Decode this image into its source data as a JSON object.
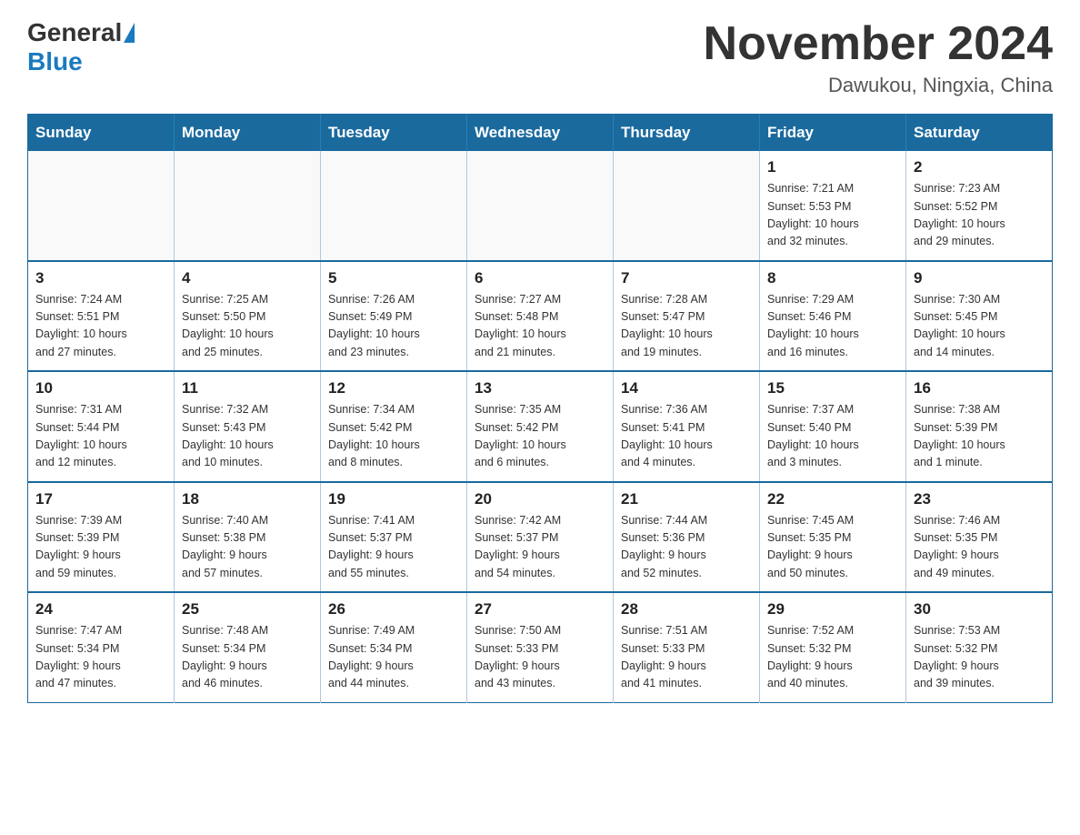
{
  "header": {
    "logo_general": "General",
    "logo_blue": "Blue",
    "month_title": "November 2024",
    "location": "Dawukou, Ningxia, China"
  },
  "days_of_week": [
    "Sunday",
    "Monday",
    "Tuesday",
    "Wednesday",
    "Thursday",
    "Friday",
    "Saturday"
  ],
  "weeks": [
    [
      {
        "day": "",
        "info": ""
      },
      {
        "day": "",
        "info": ""
      },
      {
        "day": "",
        "info": ""
      },
      {
        "day": "",
        "info": ""
      },
      {
        "day": "",
        "info": ""
      },
      {
        "day": "1",
        "info": "Sunrise: 7:21 AM\nSunset: 5:53 PM\nDaylight: 10 hours\nand 32 minutes."
      },
      {
        "day": "2",
        "info": "Sunrise: 7:23 AM\nSunset: 5:52 PM\nDaylight: 10 hours\nand 29 minutes."
      }
    ],
    [
      {
        "day": "3",
        "info": "Sunrise: 7:24 AM\nSunset: 5:51 PM\nDaylight: 10 hours\nand 27 minutes."
      },
      {
        "day": "4",
        "info": "Sunrise: 7:25 AM\nSunset: 5:50 PM\nDaylight: 10 hours\nand 25 minutes."
      },
      {
        "day": "5",
        "info": "Sunrise: 7:26 AM\nSunset: 5:49 PM\nDaylight: 10 hours\nand 23 minutes."
      },
      {
        "day": "6",
        "info": "Sunrise: 7:27 AM\nSunset: 5:48 PM\nDaylight: 10 hours\nand 21 minutes."
      },
      {
        "day": "7",
        "info": "Sunrise: 7:28 AM\nSunset: 5:47 PM\nDaylight: 10 hours\nand 19 minutes."
      },
      {
        "day": "8",
        "info": "Sunrise: 7:29 AM\nSunset: 5:46 PM\nDaylight: 10 hours\nand 16 minutes."
      },
      {
        "day": "9",
        "info": "Sunrise: 7:30 AM\nSunset: 5:45 PM\nDaylight: 10 hours\nand 14 minutes."
      }
    ],
    [
      {
        "day": "10",
        "info": "Sunrise: 7:31 AM\nSunset: 5:44 PM\nDaylight: 10 hours\nand 12 minutes."
      },
      {
        "day": "11",
        "info": "Sunrise: 7:32 AM\nSunset: 5:43 PM\nDaylight: 10 hours\nand 10 minutes."
      },
      {
        "day": "12",
        "info": "Sunrise: 7:34 AM\nSunset: 5:42 PM\nDaylight: 10 hours\nand 8 minutes."
      },
      {
        "day": "13",
        "info": "Sunrise: 7:35 AM\nSunset: 5:42 PM\nDaylight: 10 hours\nand 6 minutes."
      },
      {
        "day": "14",
        "info": "Sunrise: 7:36 AM\nSunset: 5:41 PM\nDaylight: 10 hours\nand 4 minutes."
      },
      {
        "day": "15",
        "info": "Sunrise: 7:37 AM\nSunset: 5:40 PM\nDaylight: 10 hours\nand 3 minutes."
      },
      {
        "day": "16",
        "info": "Sunrise: 7:38 AM\nSunset: 5:39 PM\nDaylight: 10 hours\nand 1 minute."
      }
    ],
    [
      {
        "day": "17",
        "info": "Sunrise: 7:39 AM\nSunset: 5:39 PM\nDaylight: 9 hours\nand 59 minutes."
      },
      {
        "day": "18",
        "info": "Sunrise: 7:40 AM\nSunset: 5:38 PM\nDaylight: 9 hours\nand 57 minutes."
      },
      {
        "day": "19",
        "info": "Sunrise: 7:41 AM\nSunset: 5:37 PM\nDaylight: 9 hours\nand 55 minutes."
      },
      {
        "day": "20",
        "info": "Sunrise: 7:42 AM\nSunset: 5:37 PM\nDaylight: 9 hours\nand 54 minutes."
      },
      {
        "day": "21",
        "info": "Sunrise: 7:44 AM\nSunset: 5:36 PM\nDaylight: 9 hours\nand 52 minutes."
      },
      {
        "day": "22",
        "info": "Sunrise: 7:45 AM\nSunset: 5:35 PM\nDaylight: 9 hours\nand 50 minutes."
      },
      {
        "day": "23",
        "info": "Sunrise: 7:46 AM\nSunset: 5:35 PM\nDaylight: 9 hours\nand 49 minutes."
      }
    ],
    [
      {
        "day": "24",
        "info": "Sunrise: 7:47 AM\nSunset: 5:34 PM\nDaylight: 9 hours\nand 47 minutes."
      },
      {
        "day": "25",
        "info": "Sunrise: 7:48 AM\nSunset: 5:34 PM\nDaylight: 9 hours\nand 46 minutes."
      },
      {
        "day": "26",
        "info": "Sunrise: 7:49 AM\nSunset: 5:34 PM\nDaylight: 9 hours\nand 44 minutes."
      },
      {
        "day": "27",
        "info": "Sunrise: 7:50 AM\nSunset: 5:33 PM\nDaylight: 9 hours\nand 43 minutes."
      },
      {
        "day": "28",
        "info": "Sunrise: 7:51 AM\nSunset: 5:33 PM\nDaylight: 9 hours\nand 41 minutes."
      },
      {
        "day": "29",
        "info": "Sunrise: 7:52 AM\nSunset: 5:32 PM\nDaylight: 9 hours\nand 40 minutes."
      },
      {
        "day": "30",
        "info": "Sunrise: 7:53 AM\nSunset: 5:32 PM\nDaylight: 9 hours\nand 39 minutes."
      }
    ]
  ]
}
